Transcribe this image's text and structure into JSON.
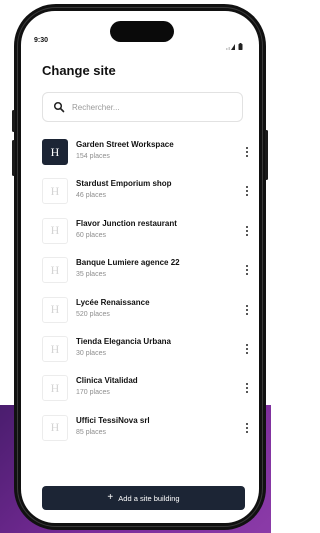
{
  "status_bar": {
    "time": "9:30",
    "icons": [
      "signal-icon",
      "battery-icon"
    ]
  },
  "page": {
    "title": "Change site"
  },
  "search": {
    "placeholder": "Rechercher..."
  },
  "sites": [
    {
      "name": "Garden Street Workspace",
      "count": "154 places",
      "logo_letter": "H",
      "active": true
    },
    {
      "name": "Stardust Emporium shop",
      "count": "46 places",
      "logo_letter": "H",
      "active": false
    },
    {
      "name": "Flavor Junction restaurant",
      "count": "60 places",
      "logo_letter": "H",
      "active": false
    },
    {
      "name": "Banque Lumiere agence 22",
      "count": "35 places",
      "logo_letter": "H",
      "active": false
    },
    {
      "name": "Lycée Renaissance",
      "count": "520 places",
      "logo_letter": "H",
      "active": false
    },
    {
      "name": "Tienda Elegancia Urbana",
      "count": "30 places",
      "logo_letter": "H",
      "active": false
    },
    {
      "name": "Clinica Vitalidad",
      "count": "170 places",
      "logo_letter": "H",
      "active": false
    },
    {
      "name": "Uffici TessiNova srl",
      "count": "85 places",
      "logo_letter": "H",
      "active": false
    }
  ],
  "footer": {
    "add_button_label": "Add a site building",
    "add_icon": "+"
  },
  "colors": {
    "accent": "#1c2535",
    "background_purple": "#7a2c9a"
  }
}
